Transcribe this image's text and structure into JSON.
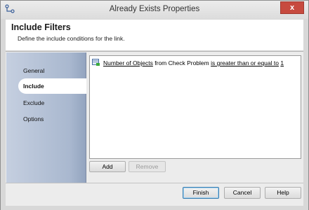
{
  "window": {
    "title": "Already Exists Properties",
    "close_label": "x"
  },
  "header": {
    "title": "Include Filters",
    "subtitle": "Define the include conditions for the link."
  },
  "nav": {
    "items": [
      {
        "label": "General",
        "selected": false
      },
      {
        "label": "Include",
        "selected": true
      },
      {
        "label": "Exclude",
        "selected": false
      },
      {
        "label": "Options",
        "selected": false
      }
    ]
  },
  "condition": {
    "field": "Number of Objects",
    "from_text": "from",
    "source": "Check Problem",
    "operator": "is greater than or equal to",
    "value": "1"
  },
  "panel_buttons": {
    "add_label": "Add",
    "remove_label": "Remove"
  },
  "footer_buttons": {
    "finish_label": "Finish",
    "cancel_label": "Cancel",
    "help_label": "Help"
  },
  "colors": {
    "nav_gradient_start": "#c5cfe0",
    "nav_gradient_end": "#93a4bf",
    "close_button": "#c74a3f",
    "default_button_border": "#3c7fb1"
  }
}
